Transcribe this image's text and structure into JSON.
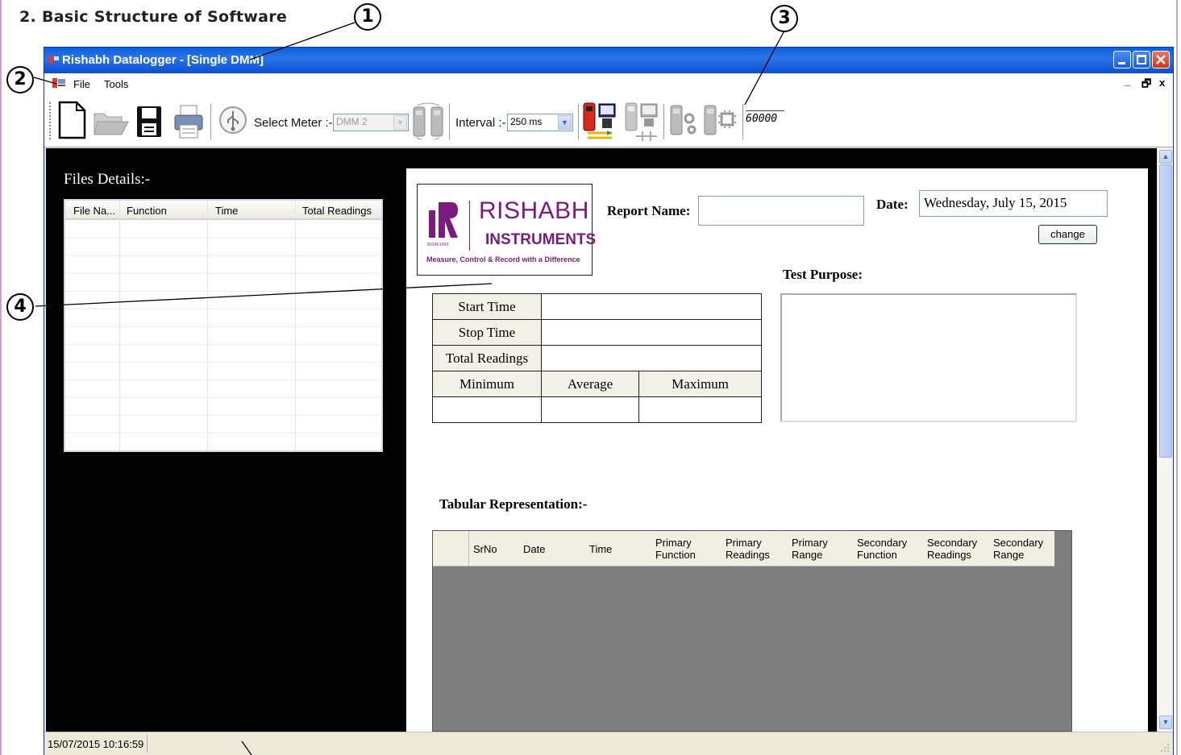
{
  "page": {
    "heading": "2. Basic Structure of Software",
    "callouts": [
      "1",
      "2",
      "3",
      "4"
    ]
  },
  "window": {
    "title": "Rishabh Datalogger - [Single DMM]",
    "controls": [
      "minimize",
      "maximize",
      "close"
    ]
  },
  "menu": {
    "items": [
      "File",
      "Tools"
    ],
    "mdi_restore": "🗗",
    "mdi_close": "x"
  },
  "toolbar": {
    "icons": [
      "new-file-icon",
      "open-folder-icon",
      "save-disk-icon",
      "printer-icon",
      "usb-icon",
      "meter-pair-icon",
      "meter-pc-link-icon",
      "meter-network-icon",
      "meter-settings-icon",
      "meter-lcd-icon"
    ],
    "select_meter_label": "Select Meter :-",
    "select_meter_value": "DMM 2",
    "interval_label": "Interval :-",
    "interval_value": "250 ms",
    "lcd_display": "60000"
  },
  "files_panel": {
    "title": "Files Details:-",
    "columns": [
      "File Na...",
      "Function",
      "Time",
      "Total Readings"
    ],
    "rows": []
  },
  "report": {
    "logo": {
      "line1": "RISHABH",
      "line2": "INSTRUMENTS",
      "small": "RISHABH",
      "tagline": "Measure, Control & Record with a Difference",
      "color": "#7a1a7d"
    },
    "report_name_label": "Report Name:",
    "report_name_value": "",
    "date_label": "Date:",
    "date_value": "Wednesday, July 15, 2015",
    "change_button": "change",
    "test_purpose_label": "Test Purpose:",
    "summary": {
      "start_time_label": "Start Time",
      "stop_time_label": "Stop Time",
      "total_readings_label": "Total Readings",
      "minimum_label": "Minimum",
      "average_label": "Average",
      "maximum_label": "Maximum"
    },
    "tabular_label": "Tabular Representation:-",
    "table_columns": [
      "SrNo",
      "Date",
      "Time",
      "Primary Function",
      "Primary Readings",
      "Primary Range",
      "Secondary Function",
      "Secondary Readings",
      "Secondary Range"
    ]
  },
  "status": {
    "timestamp": "15/07/2015 10:16:59"
  }
}
